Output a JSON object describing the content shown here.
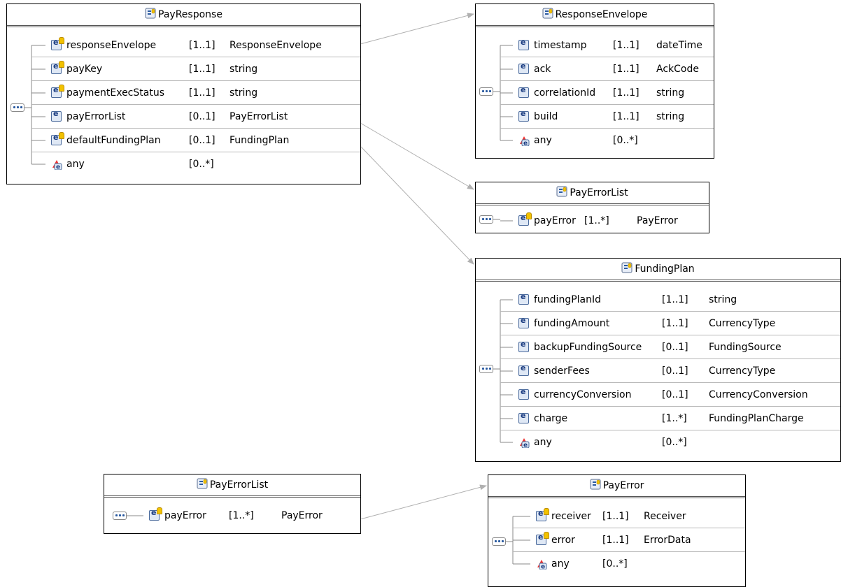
{
  "colors": {
    "element_icon": "#dfe8f5",
    "element_icon_border": "#4a6a9c",
    "required_marker": "#f2c200",
    "connector": "#b0b0b0"
  },
  "boxes": {
    "pay_response": {
      "title": "PayResponse",
      "rows": [
        {
          "name": "responseEnvelope",
          "mult": "[1..1]",
          "type": "ResponseEnvelope",
          "icon": "element-required-icon"
        },
        {
          "name": "payKey",
          "mult": "[1..1]",
          "type": "string",
          "icon": "element-required-icon"
        },
        {
          "name": "paymentExecStatus",
          "mult": "[1..1]",
          "type": "string",
          "icon": "element-required-icon"
        },
        {
          "name": "payErrorList",
          "mult": "[0..1]",
          "type": "PayErrorList",
          "icon": "element-icon"
        },
        {
          "name": "defaultFundingPlan",
          "mult": "[0..1]",
          "type": "FundingPlan",
          "icon": "element-required-icon"
        },
        {
          "name": "any",
          "mult": "[0..*]",
          "type": "",
          "icon": "any-element-icon"
        }
      ]
    },
    "response_envelope": {
      "title": "ResponseEnvelope",
      "rows": [
        {
          "name": "timestamp",
          "mult": "[1..1]",
          "type": "dateTime",
          "icon": "element-icon"
        },
        {
          "name": "ack",
          "mult": "[1..1]",
          "type": "AckCode",
          "icon": "element-icon"
        },
        {
          "name": "correlationId",
          "mult": "[1..1]",
          "type": "string",
          "icon": "element-icon"
        },
        {
          "name": "build",
          "mult": "[1..1]",
          "type": "string",
          "icon": "element-icon"
        },
        {
          "name": "any",
          "mult": "[0..*]",
          "type": "",
          "icon": "any-element-icon"
        }
      ]
    },
    "pay_error_list_1": {
      "title": "PayErrorList",
      "rows": [
        {
          "name": "payError",
          "mult": "[1..*]",
          "type": "PayError",
          "icon": "element-required-icon"
        }
      ]
    },
    "funding_plan": {
      "title": "FundingPlan",
      "rows": [
        {
          "name": "fundingPlanId",
          "mult": "[1..1]",
          "type": "string",
          "icon": "element-icon"
        },
        {
          "name": "fundingAmount",
          "mult": "[1..1]",
          "type": "CurrencyType",
          "icon": "element-icon"
        },
        {
          "name": "backupFundingSource",
          "mult": "[0..1]",
          "type": "FundingSource",
          "icon": "element-icon"
        },
        {
          "name": "senderFees",
          "mult": "[0..1]",
          "type": "CurrencyType",
          "icon": "element-icon"
        },
        {
          "name": "currencyConversion",
          "mult": "[0..1]",
          "type": "CurrencyConversion",
          "icon": "element-icon"
        },
        {
          "name": "charge",
          "mult": "[1..*]",
          "type": "FundingPlanCharge",
          "icon": "element-icon"
        },
        {
          "name": "any",
          "mult": "[0..*]",
          "type": "",
          "icon": "any-element-icon"
        }
      ]
    },
    "pay_error_list_2": {
      "title": "PayErrorList",
      "rows": [
        {
          "name": "payError",
          "mult": "[1..*]",
          "type": "PayError",
          "icon": "element-required-icon"
        }
      ]
    },
    "pay_error": {
      "title": "PayError",
      "rows": [
        {
          "name": "receiver",
          "mult": "[1..1]",
          "type": "Receiver",
          "icon": "element-required-icon"
        },
        {
          "name": "error",
          "mult": "[1..1]",
          "type": "ErrorData",
          "icon": "element-required-icon"
        },
        {
          "name": "any",
          "mult": "[0..*]",
          "type": "",
          "icon": "any-element-icon"
        }
      ]
    }
  }
}
